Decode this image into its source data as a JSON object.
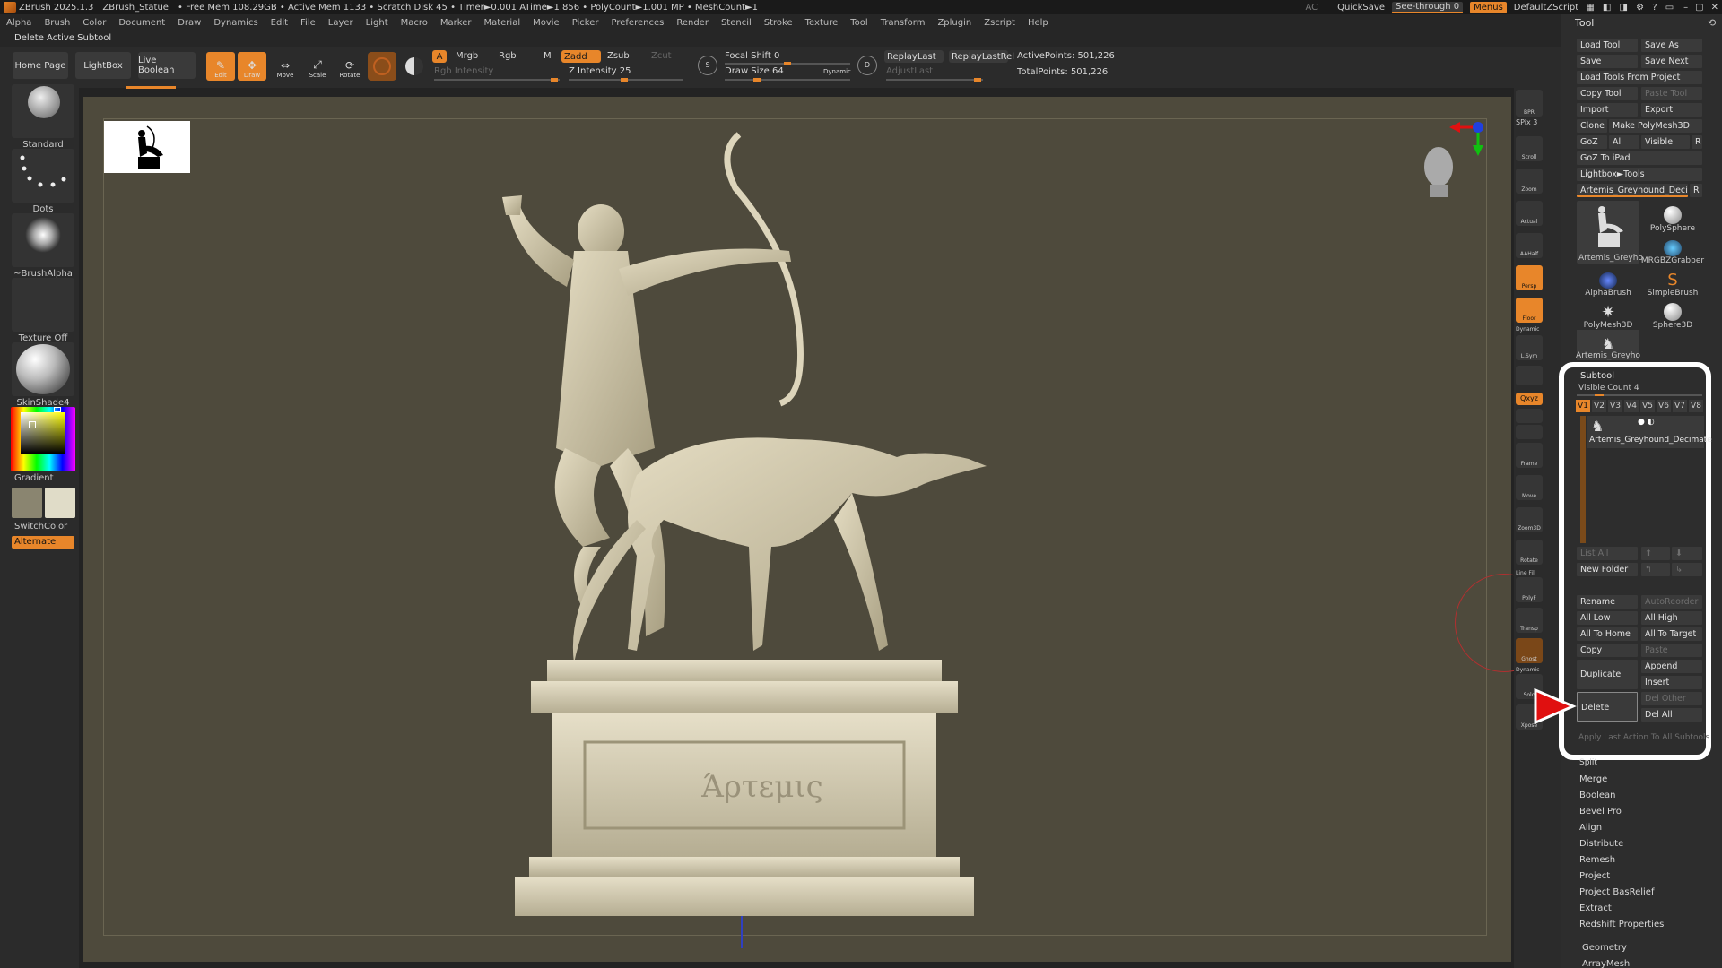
{
  "titlebar": {
    "app": "ZBrush 2025.1.3",
    "doc": "ZBrush_Statue",
    "stats": "• Free Mem 108.29GB • Active Mem 1133 • Scratch Disk 45 • Timer►0.001 ATime►1.856 • PolyCount►1.001 MP • MeshCount►1",
    "ac": "AC",
    "quicksave": "QuickSave",
    "seethrough": "See-through",
    "seethrough_value": "0",
    "menus": "Menus",
    "script": "DefaultZScript"
  },
  "menu": [
    "Alpha",
    "Brush",
    "Color",
    "Document",
    "Draw",
    "Dynamics",
    "Edit",
    "File",
    "Layer",
    "Light",
    "Macro",
    "Marker",
    "Material",
    "Movie",
    "Picker",
    "Preferences",
    "Render",
    "Stencil",
    "Stroke",
    "Texture",
    "Tool",
    "Transform",
    "Zplugin",
    "Zscript",
    "Help"
  ],
  "status": "Delete Active Subtool",
  "toolbar": {
    "home": "Home Page",
    "lightbox": "LightBox",
    "liveboolean": "Live Boolean",
    "edit": "Edit",
    "draw": "Draw",
    "move": "Move",
    "scale": "Scale",
    "rotate": "Rotate",
    "a": "A",
    "mrgb": "Mrgb",
    "rgb": "Rgb",
    "m": "M",
    "zadd": "Zadd",
    "zsub": "Zsub",
    "zcut": "Zcut",
    "rgb_intensity": "Rgb Intensity",
    "z_intensity": "Z Intensity 25",
    "focal_shift": "Focal Shift 0",
    "draw_size": "Draw Size 64",
    "dynamic": "Dynamic",
    "replaylast": "ReplayLast",
    "replaylastrel": "ReplayLastRel",
    "adjustlast": "AdjustLast",
    "activepoints": "ActivePoints: 501,226",
    "totalpoints": "TotalPoints: 501,226",
    "s": "S",
    "d": "D"
  },
  "leftshelf": {
    "standard": "Standard",
    "dots": "Dots",
    "brushalpha": "~BrushAlpha",
    "texture": "Texture Off",
    "material": "SkinShade4",
    "gradient": "Gradient",
    "switchcolor": "SwitchColor",
    "alternate": "Alternate"
  },
  "canvas": {
    "inscription": "Άρτεμις"
  },
  "rightshelf": [
    "BPR",
    "SPix 3",
    "Scroll",
    "Zoom",
    "Actual",
    "AAHalf",
    "Persp",
    "Floor",
    "Dynamic",
    "L.Sym",
    "",
    "Qxyz",
    "",
    "",
    "Frame",
    "Move",
    "Zoom3D",
    "Rotate",
    "Line Fill",
    "PolyF",
    "Transp",
    "Ghost",
    "Dynamic",
    "Solo",
    "Xpose"
  ],
  "tool": {
    "title": "Tool",
    "load_tool": "Load Tool",
    "save_as": "Save As",
    "save": "Save",
    "save_next": "Save Next",
    "load_from_project": "Load Tools From Project",
    "copy_tool": "Copy Tool",
    "paste_tool": "Paste Tool",
    "import": "Import",
    "export": "Export",
    "clone": "Clone",
    "make_polymesh": "Make PolyMesh3D",
    "goz": "GoZ",
    "all": "All",
    "visible": "Visible",
    "r": "R",
    "goz_ipad": "GoZ To iPad",
    "lightbox_tools": "Lightbox►Tools",
    "current_tool": "Artemis_Greyhound_Decimat",
    "thumbs": [
      "Artemis_Greyho",
      "PolySphere",
      "MRGBZGrabber",
      "AlphaBrush",
      "SimpleBrush",
      "PolyMesh3D",
      "Sphere3D",
      "Artemis_Greyho"
    ]
  },
  "subtool": {
    "title": "Subtool",
    "visible_count": "Visible Count 4",
    "versions": [
      "V1",
      "V2",
      "V3",
      "V4",
      "V5",
      "V6",
      "V7",
      "V8"
    ],
    "item_name": "Artemis_Greyhound_Decimate",
    "list_all": "List All",
    "new_folder": "New Folder",
    "rename": "Rename",
    "autoreorder": "AutoReorder",
    "all_low": "All Low",
    "all_high": "All High",
    "all_to_home": "All To Home",
    "all_to_target": "All To Target",
    "copy": "Copy",
    "paste": "Paste",
    "duplicate": "Duplicate",
    "append": "Append",
    "insert": "Insert",
    "delete": "Delete",
    "del_other": "Del Other",
    "del_all": "Del All",
    "apply_last": "Apply Last Action To All Subtools"
  },
  "below_subtool": [
    "Split",
    "Merge",
    "Boolean",
    "Bevel Pro",
    "Align",
    "Distribute",
    "Remesh",
    "Project",
    "Project BasRelief",
    "Extract",
    "Redshift Properties"
  ],
  "geometry": "Geometry",
  "arraymesh": "ArrayMesh",
  "colors": {
    "accent": "#e8862a",
    "canvas": "#4e4a3c",
    "panel": "#2d2d2d",
    "arrow": "#e01010"
  }
}
